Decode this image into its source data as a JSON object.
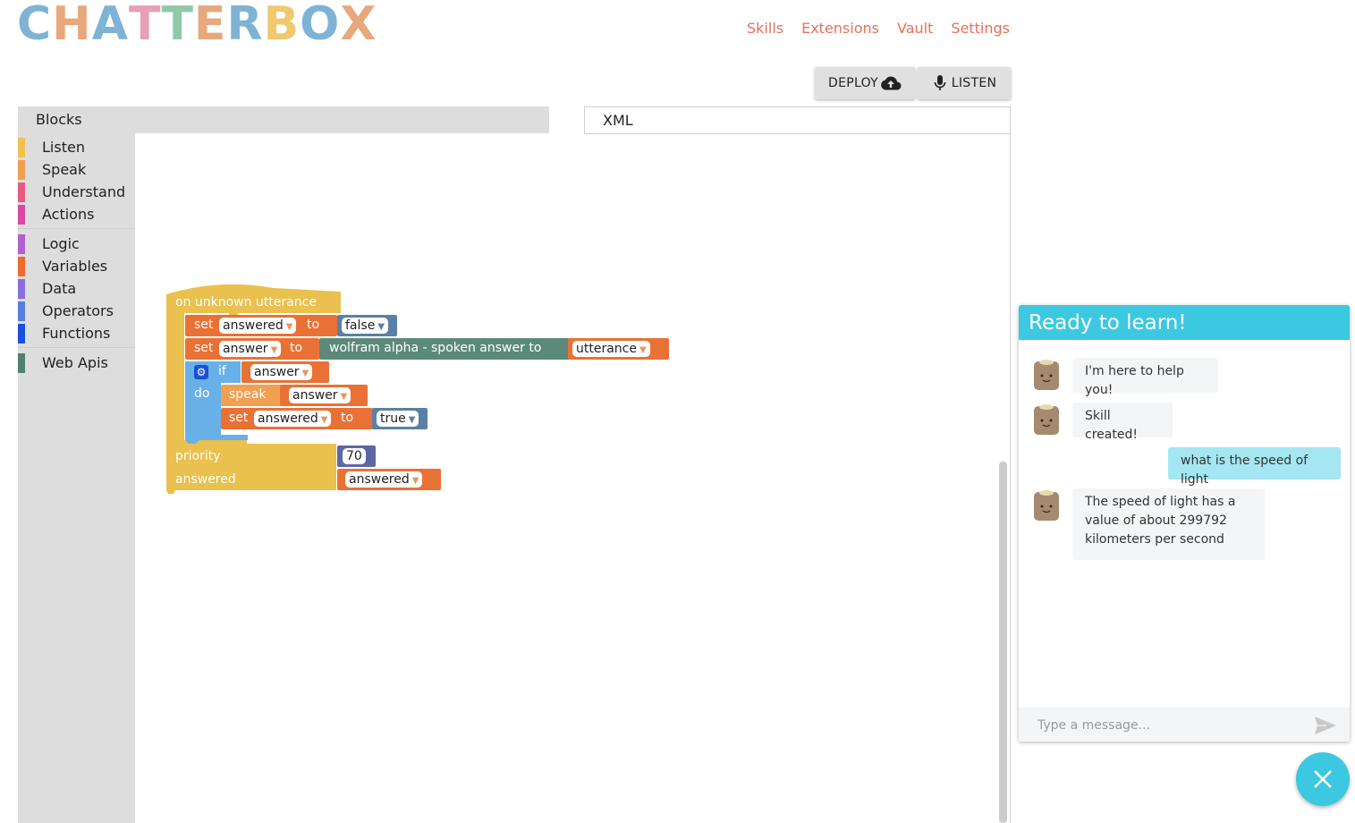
{
  "logo": {
    "letters": [
      "C",
      "H",
      "A",
      "T",
      "T",
      "E",
      "R",
      "B",
      "O",
      "X"
    ],
    "colors": [
      "#7fb3d5",
      "#e8a87c",
      "#7fb3d5",
      "#e8a0b4",
      "#8fc9a8",
      "#e8a87c",
      "#7fb3d5",
      "#f0c86e",
      "#7fb3d5",
      "#e8a87c"
    ]
  },
  "nav": {
    "items": [
      "Skills",
      "Extensions",
      "Vault",
      "Settings"
    ],
    "color": "#e8705a"
  },
  "toolbar": {
    "deploy_label": "DEPLOY",
    "listen_label": "LISTEN"
  },
  "tabs": {
    "blocks": "Blocks",
    "xml": "XML"
  },
  "toolbox": {
    "categories": [
      {
        "label": "Listen",
        "color": "#f0c050"
      },
      {
        "label": "Speak",
        "color": "#f0a050"
      },
      {
        "label": "Understand",
        "color": "#e85a80"
      },
      {
        "label": "Actions",
        "color": "#d84aa0"
      },
      {
        "label": "Logic",
        "color": "#b060d0"
      },
      {
        "label": "Variables",
        "color": "#ee6a30"
      },
      {
        "label": "Data",
        "color": "#8a6ee0"
      },
      {
        "label": "Operators",
        "color": "#5a7ee0"
      },
      {
        "label": "Functions",
        "color": "#1a50e0"
      },
      {
        "label": "Web Apis",
        "color": "#508070"
      }
    ]
  },
  "blocks": {
    "event": "on unknown utterance",
    "set1": {
      "kw": "set",
      "var": "answered",
      "to": "to",
      "value": "false"
    },
    "set2": {
      "kw": "set",
      "var": "answer",
      "to": "to",
      "fn": "wolfram alpha - spoken answer to",
      "arg": "utterance"
    },
    "if": {
      "kw_if": "if",
      "cond": "answer",
      "kw_do": "do"
    },
    "speak": {
      "kw": "speak",
      "var": "answer"
    },
    "set3": {
      "kw": "set",
      "var": "answered",
      "to": "to",
      "value": "true"
    },
    "priority": {
      "label": "priority",
      "value": "70"
    },
    "answered": {
      "label": "answered",
      "var": "answered"
    },
    "colors": {
      "event": "#eac04e",
      "variable": "#ea7136",
      "logic": "#6ab0e8",
      "value": "#5b80a5",
      "webapi": "#5b8a7a",
      "number": "#5b68a5",
      "speak": "#f0a050"
    }
  },
  "chat": {
    "header": "Ready to learn!",
    "messages": [
      {
        "from": "bot",
        "text": "I'm here to help you!"
      },
      {
        "from": "bot",
        "text": "Skill created!"
      },
      {
        "from": "user",
        "text": "what is the speed of light"
      },
      {
        "from": "bot",
        "text": "The speed of light has a value of about 299792 kilometers per second"
      }
    ],
    "input_placeholder": "Type a message...",
    "accent": "#3cc8e1"
  }
}
